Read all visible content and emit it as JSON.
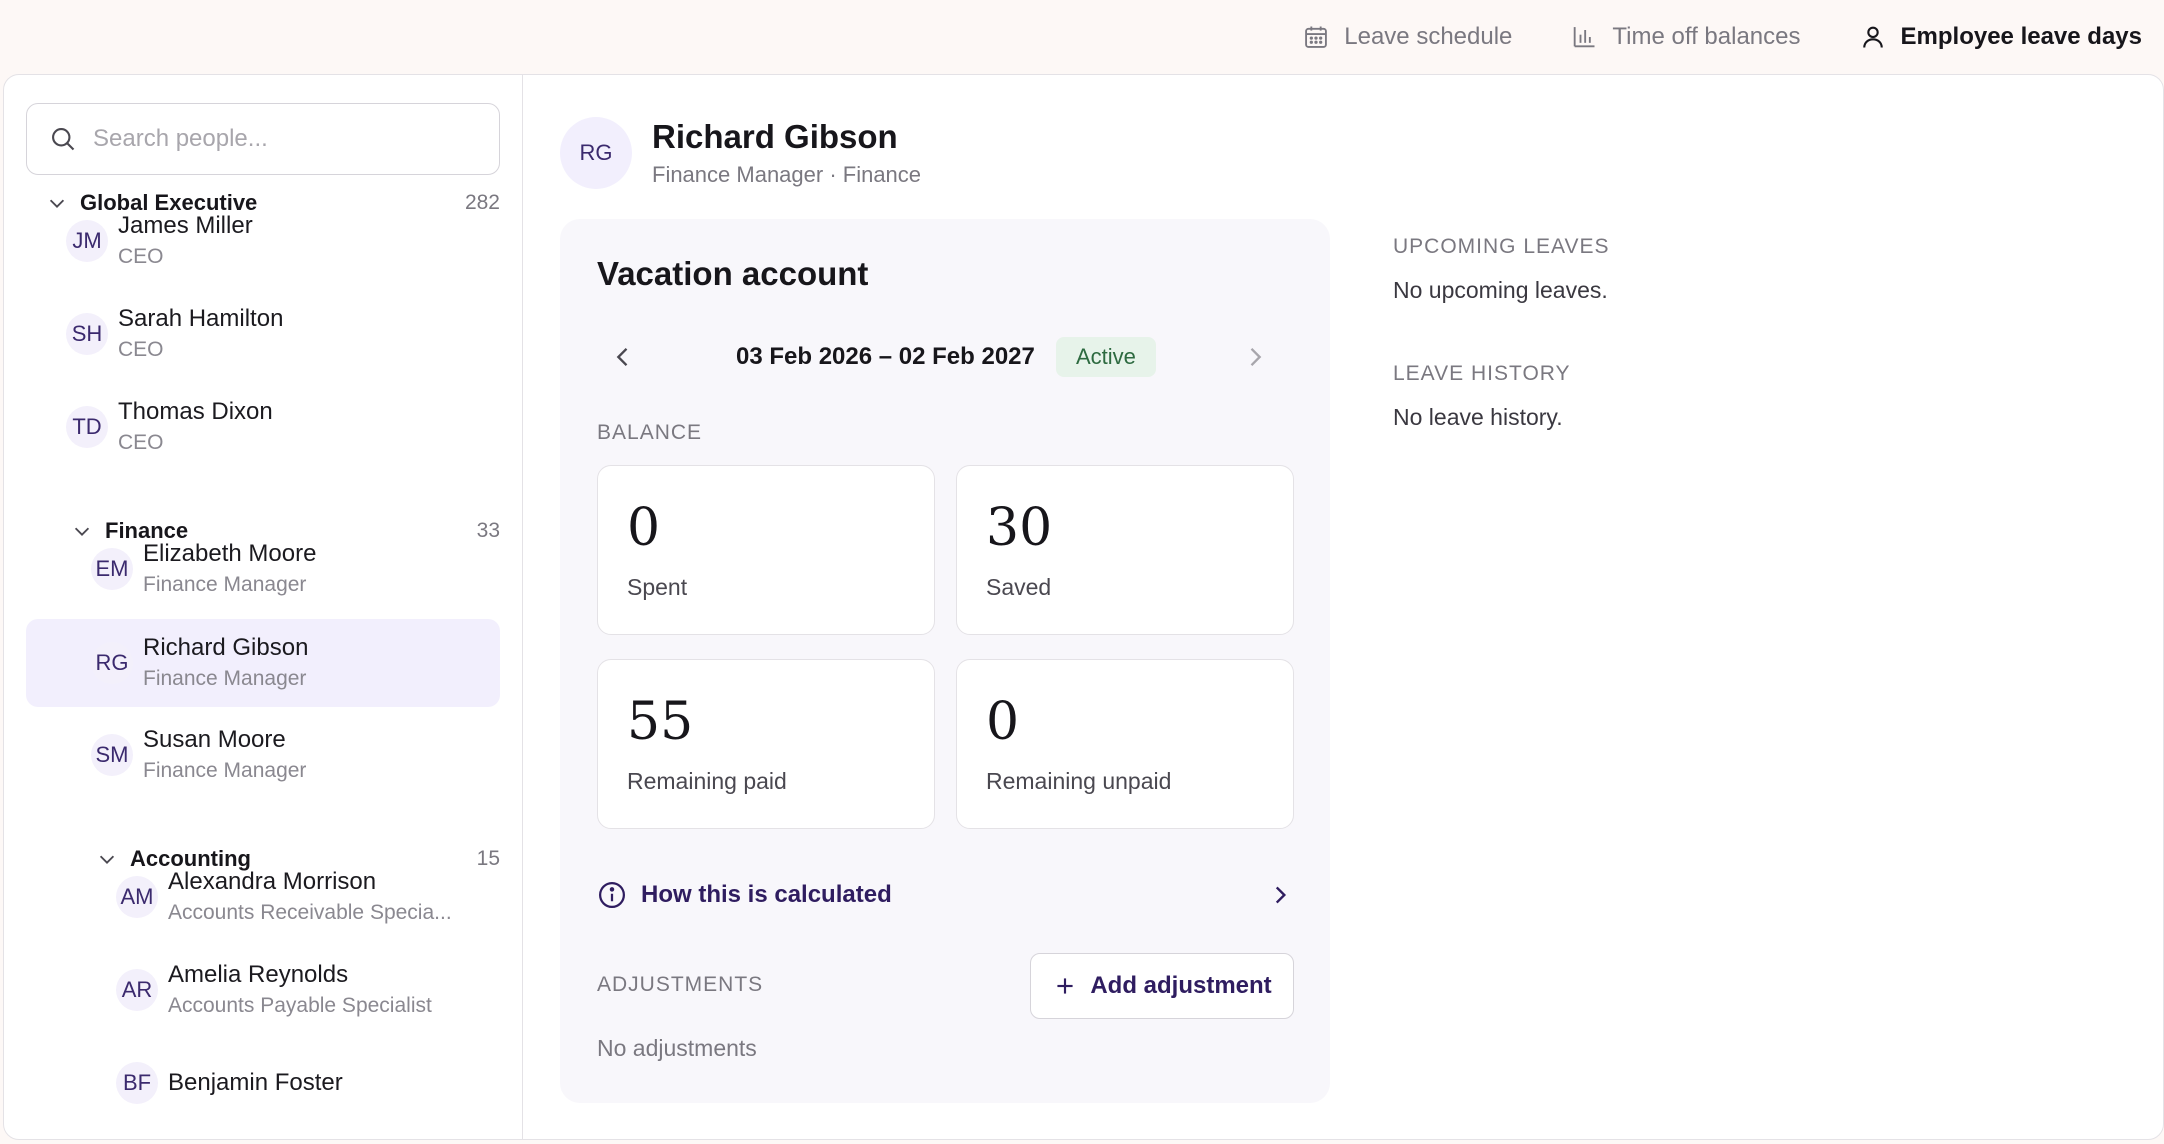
{
  "nav": {
    "items": [
      {
        "label": "Leave schedule",
        "icon": "calendar-icon"
      },
      {
        "label": "Time off balances",
        "icon": "bar-chart-icon"
      },
      {
        "label": "Employee leave days",
        "icon": "user-icon",
        "active": true
      }
    ]
  },
  "sidebar": {
    "search_placeholder": "Search people...",
    "groups": [
      {
        "name": "Global Executive",
        "count": "282"
      },
      {
        "name": "Finance",
        "count": "33"
      },
      {
        "name": "Accounting",
        "count": "15"
      }
    ],
    "people": [
      {
        "initials": "JM",
        "name": "James Miller",
        "role": "CEO"
      },
      {
        "initials": "SH",
        "name": "Sarah Hamilton",
        "role": "CEO"
      },
      {
        "initials": "TD",
        "name": "Thomas Dixon",
        "role": "CEO"
      },
      {
        "initials": "EM",
        "name": "Elizabeth Moore",
        "role": "Finance Manager"
      },
      {
        "initials": "RG",
        "name": "Richard Gibson",
        "role": "Finance Manager",
        "selected": true
      },
      {
        "initials": "SM",
        "name": "Susan Moore",
        "role": "Finance Manager"
      },
      {
        "initials": "AM",
        "name": "Alexandra Morrison",
        "role": "Accounts Receivable Specia..."
      },
      {
        "initials": "AR",
        "name": "Amelia Reynolds",
        "role": "Accounts Payable Specialist"
      },
      {
        "initials": "BF",
        "name": "Benjamin Foster",
        "role": ""
      }
    ]
  },
  "employee": {
    "initials": "RG",
    "name": "Richard Gibson",
    "subtitle": "Finance Manager · Finance"
  },
  "account": {
    "title": "Vacation account",
    "period": "03 Feb 2026 – 02 Feb 2027",
    "status": "Active",
    "balance_label": "BALANCE",
    "stats": {
      "spent": {
        "value": "0",
        "label": "Spent"
      },
      "saved": {
        "value": "30",
        "label": "Saved"
      },
      "remaining_paid": {
        "value": "55",
        "label": "Remaining paid"
      },
      "remaining_unpaid": {
        "value": "0",
        "label": "Remaining unpaid"
      }
    },
    "how_calculated": "How this is calculated",
    "adjustments_label": "ADJUSTMENTS",
    "add_adjustment": "Add adjustment",
    "no_adjustments": "No adjustments"
  },
  "upcoming": {
    "label": "UPCOMING LEAVES",
    "text": "No upcoming leaves."
  },
  "history": {
    "label": "LEAVE HISTORY",
    "text": "No leave history."
  },
  "colors": {
    "accent": "#2f1d60",
    "selected_bg": "#f2effd",
    "active_badge_bg": "#e7f3ea",
    "active_badge_text": "#2d6a40"
  }
}
